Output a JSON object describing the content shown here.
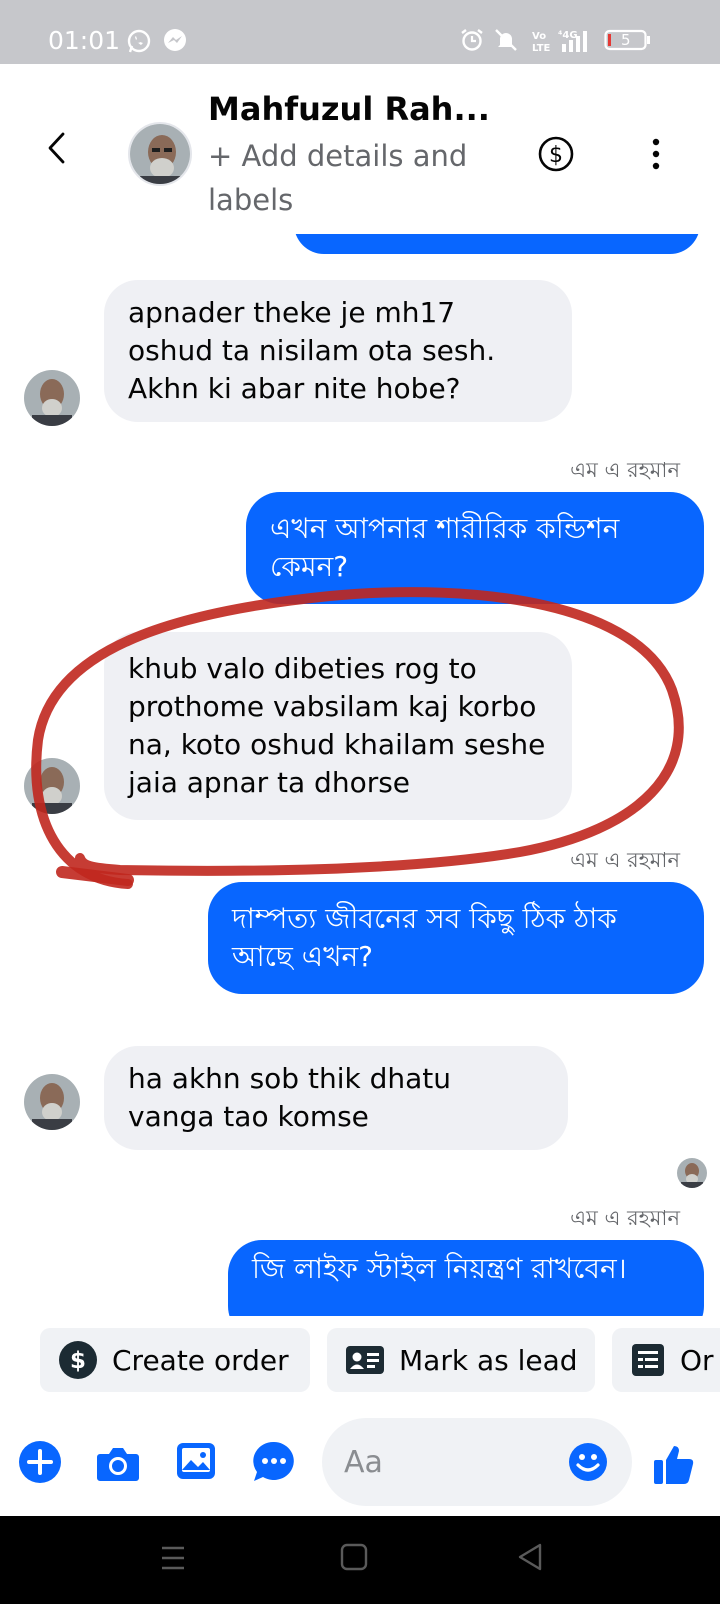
{
  "status_bar": {
    "time": "01:01",
    "battery": "5",
    "icons": [
      "whatsapp-icon",
      "messenger-icon",
      "alarm-icon",
      "mute-icon",
      "volte-icon",
      "signal-4g-icon",
      "battery-icon"
    ]
  },
  "header": {
    "name": "Mahfuzul Rah...",
    "subtitle": "+ Add details and labels",
    "icons": [
      "back-arrow-icon",
      "dollar-circle-icon",
      "more-vertical-icon"
    ]
  },
  "messages": [
    {
      "direction": "incoming",
      "text": "apnader theke je mh17 oshud ta nisilam ota sesh. Akhn ki abar nite hobe?"
    },
    {
      "direction": "outgoing",
      "sender": "এম এ রহমান",
      "text": "এখন আপনার শারীরিক কন্ডিশন কেমন?"
    },
    {
      "direction": "incoming",
      "text": "khub valo dibeties rog to prothome vabsilam kaj korbo na, koto oshud khailam seshe jaia apnar ta dhorse",
      "highlighted": true
    },
    {
      "direction": "outgoing",
      "sender": "এম এ রহমান",
      "text": "দাম্পত্য জীবনের সব কিছু ঠিক ঠাক আছে এখন?"
    },
    {
      "direction": "incoming",
      "text": "ha akhn sob thik dhatu vanga tao komse"
    },
    {
      "direction": "outgoing",
      "sender": "এম এ রহমান",
      "text": "জি লাইফ স্টাইল নিয়ন্ত্রণ রাখবেন।"
    }
  ],
  "actions": [
    {
      "label": "Create order",
      "icon": "dollar-circle-icon"
    },
    {
      "label": "Mark as lead",
      "icon": "contact-card-icon"
    },
    {
      "label": "Or",
      "icon": "order-list-icon"
    }
  ],
  "composer": {
    "placeholder": "Aa",
    "icons": [
      "plus-icon",
      "camera-icon",
      "gallery-icon",
      "chat-bubble-icon",
      "emoji-icon",
      "thumbs-up-icon"
    ]
  },
  "colors": {
    "accent": "#0866ff",
    "incoming_bubble": "#eff0f4",
    "annotation": "#c0271e",
    "status_bar": "#c6c7cb"
  }
}
